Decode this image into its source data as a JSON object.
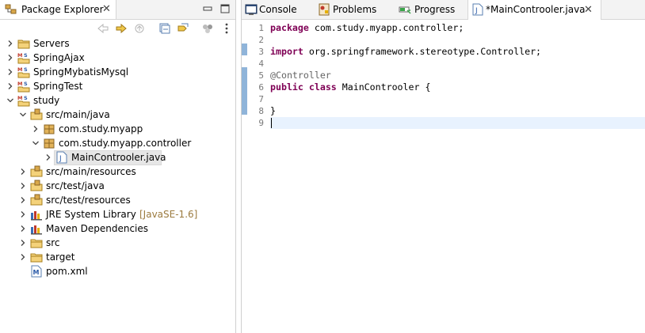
{
  "explorer": {
    "title": "Package Explorer",
    "tree": [
      {
        "label": "Servers",
        "icon": "folder-icon",
        "expanded": false,
        "indent": 0
      },
      {
        "label": "SpringAjax",
        "icon": "maven-project-icon",
        "expanded": false,
        "indent": 0
      },
      {
        "label": "SpringMybatisMysql",
        "icon": "maven-project-icon",
        "expanded": false,
        "indent": 0
      },
      {
        "label": "SpringTest",
        "icon": "maven-project-icon",
        "expanded": false,
        "indent": 0
      },
      {
        "label": "study",
        "icon": "maven-project-icon",
        "expanded": true,
        "indent": 0
      },
      {
        "label": "src/main/java",
        "icon": "source-folder-icon",
        "expanded": true,
        "indent": 1
      },
      {
        "label": "com.study.myapp",
        "icon": "package-icon",
        "expanded": false,
        "indent": 2
      },
      {
        "label": "com.study.myapp.controller",
        "icon": "package-icon",
        "expanded": true,
        "indent": 2
      },
      {
        "label": "MainControoler.java",
        "icon": "java-file-icon",
        "expanded": false,
        "indent": 3,
        "selected": true
      },
      {
        "label": "src/main/resources",
        "icon": "source-folder-icon",
        "expanded": false,
        "indent": 1
      },
      {
        "label": "src/test/java",
        "icon": "source-folder-icon",
        "expanded": false,
        "indent": 1
      },
      {
        "label": "src/test/resources",
        "icon": "source-folder-icon",
        "expanded": false,
        "indent": 1
      },
      {
        "label": "JRE System Library",
        "decoration": "[JavaSE-1.6]",
        "icon": "library-icon",
        "expanded": false,
        "indent": 1
      },
      {
        "label": "Maven Dependencies",
        "icon": "library-icon",
        "expanded": false,
        "indent": 1
      },
      {
        "label": "src",
        "icon": "folder-icon",
        "expanded": false,
        "indent": 1
      },
      {
        "label": "target",
        "icon": "folder-icon",
        "expanded": false,
        "indent": 1
      },
      {
        "label": "pom.xml",
        "icon": "maven-file-icon",
        "expanded": null,
        "indent": 1
      }
    ]
  },
  "editor_tabs": [
    {
      "label": "Console",
      "icon": "console-icon"
    },
    {
      "label": "Problems",
      "icon": "problems-icon"
    },
    {
      "label": "Progress",
      "icon": "progress-icon"
    },
    {
      "label": "*MainControoler.java",
      "icon": "java-file-icon",
      "active": true
    }
  ],
  "code": {
    "line_numbers": [
      "1",
      "2",
      "3",
      "4",
      "5",
      "6",
      "7",
      "8",
      "9"
    ],
    "lines": [
      [
        {
          "t": "package",
          "c": "kw"
        },
        {
          "t": " com.study.myapp.controller;",
          "c": ""
        }
      ],
      [],
      [
        {
          "t": "import",
          "c": "kw"
        },
        {
          "t": " org.springframework.stereotype.Controller;",
          "c": ""
        }
      ],
      [],
      [
        {
          "t": "@Controller",
          "c": "ann"
        }
      ],
      [
        {
          "t": "public",
          "c": "kw"
        },
        {
          "t": " ",
          "c": ""
        },
        {
          "t": "class",
          "c": "kw"
        },
        {
          "t": " MainControoler {",
          "c": ""
        }
      ],
      [],
      [
        {
          "t": "}",
          "c": ""
        }
      ],
      []
    ]
  },
  "colors": {
    "keyword": "#7f0055",
    "annotation": "#646464",
    "current_line": "#e8f2fe",
    "change_bar": "#8fb4d9"
  }
}
